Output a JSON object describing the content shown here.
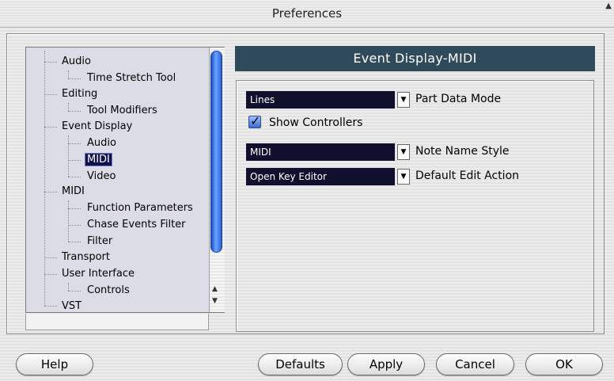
{
  "window": {
    "title": "Preferences"
  },
  "tree": {
    "items": [
      {
        "label": "Audio",
        "level": 0
      },
      {
        "label": "Time Stretch Tool",
        "level": 1
      },
      {
        "label": "Editing",
        "level": 0
      },
      {
        "label": "Tool Modifiers",
        "level": 1
      },
      {
        "label": "Event Display",
        "level": 0
      },
      {
        "label": "Audio",
        "level": 1
      },
      {
        "label": "MIDI",
        "level": 1,
        "selected": true
      },
      {
        "label": "Video",
        "level": 1
      },
      {
        "label": "MIDI",
        "level": 0
      },
      {
        "label": "Function Parameters",
        "level": 1
      },
      {
        "label": "Chase Events Filter",
        "level": 1
      },
      {
        "label": "Filter",
        "level": 1
      },
      {
        "label": "Transport",
        "level": 0
      },
      {
        "label": "User Interface",
        "level": 0
      },
      {
        "label": "Controls",
        "level": 1
      },
      {
        "label": "VST",
        "level": 0
      }
    ]
  },
  "panel": {
    "header": "Event Display-MIDI",
    "part_data_mode": {
      "value": "Lines",
      "label": "Part Data Mode"
    },
    "show_controllers": {
      "label": "Show Controllers",
      "checked": true
    },
    "note_name_style": {
      "value": "MIDI",
      "label": "Note Name Style"
    },
    "default_edit_action": {
      "value": "Open Key Editor",
      "label": "Default Edit Action"
    }
  },
  "buttons": {
    "help": "Help",
    "defaults": "Defaults",
    "apply": "Apply",
    "cancel": "Cancel",
    "ok": "OK"
  },
  "colors": {
    "header_bg": "#2f4a5a",
    "selection_bg": "#10104a",
    "dropdown_bg": "#10102e",
    "scroll_thumb": "#2a66e8"
  }
}
